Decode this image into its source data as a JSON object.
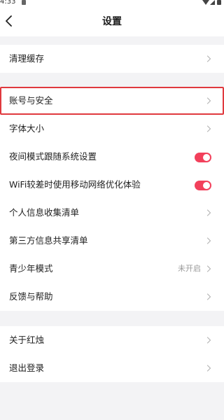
{
  "status_bar": {
    "time": "4:33"
  },
  "header": {
    "title": "设置"
  },
  "group1": {
    "items": [
      {
        "label": "清理缓存"
      }
    ]
  },
  "group2": {
    "items": [
      {
        "label": "账号与安全"
      },
      {
        "label": "字体大小"
      },
      {
        "label": "夜间模式跟随系统设置",
        "toggle": "on"
      },
      {
        "label": "WiFi较差时使用移动网络优化体验",
        "toggle": "on"
      },
      {
        "label": "个人信息收集清单"
      },
      {
        "label": "第三方信息共享清单"
      },
      {
        "label": "青少年模式",
        "value": "未开启"
      },
      {
        "label": "反馈与帮助"
      }
    ]
  },
  "group3": {
    "items": [
      {
        "label": "关于红烛"
      },
      {
        "label": "退出登录"
      }
    ]
  },
  "colors": {
    "toggle_on": "#f2405b",
    "highlight_border": "#e0393e",
    "background": "#f3f3f5"
  }
}
